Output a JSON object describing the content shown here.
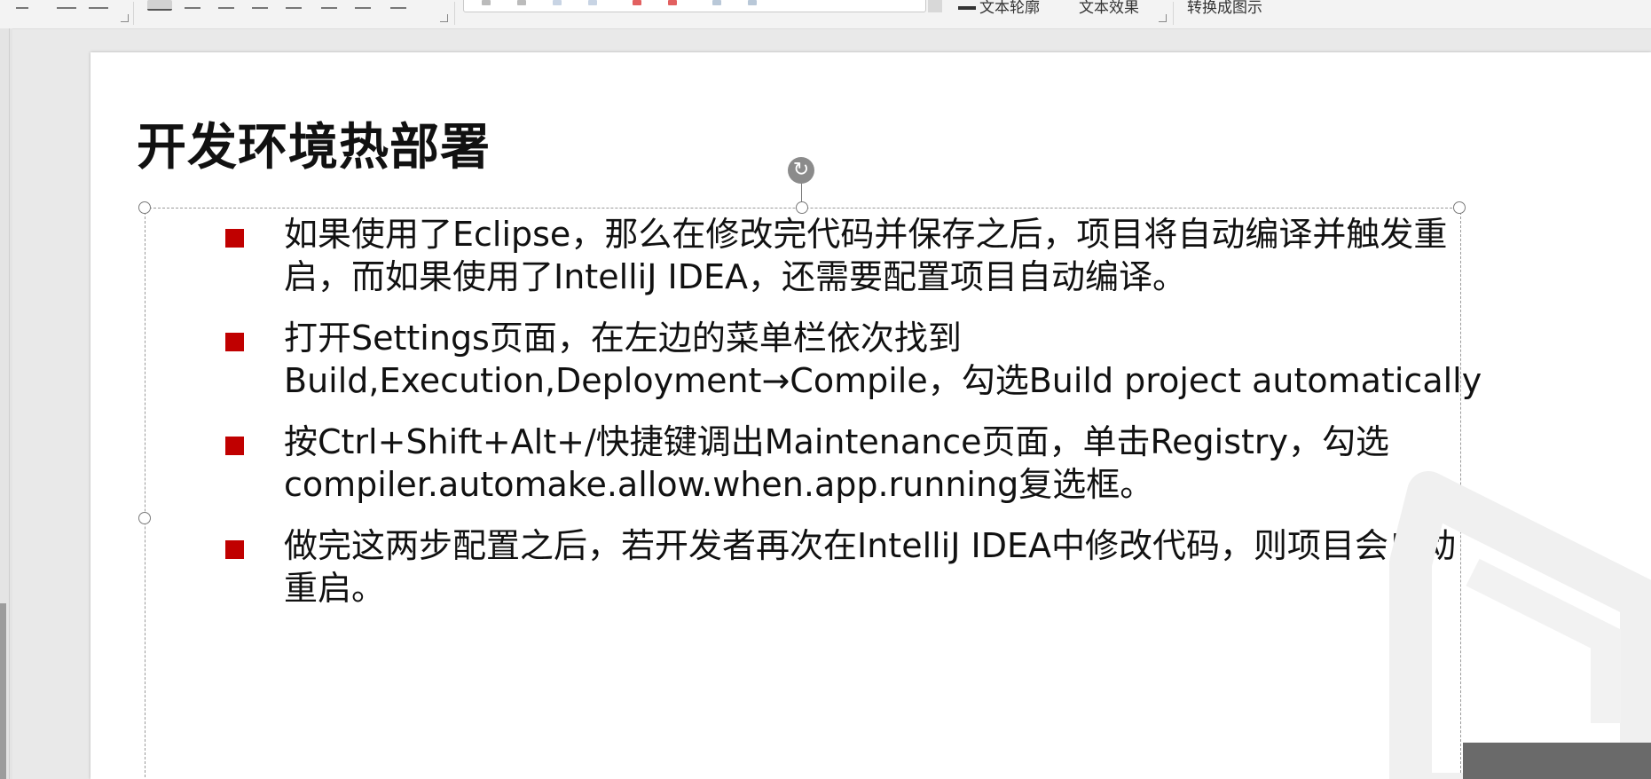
{
  "ribbon": {
    "text_outline_label": "文本轮廓",
    "text_effect_label": "文本效果",
    "convert_label": "转换成图示"
  },
  "slide": {
    "title": "开发环境热部署",
    "items": [
      {
        "text": "如果使用了Eclipse，那么在修改完代码并保存之后，项目将自动编译并触发重\n启，而如果使用了IntelliJ IDEA，还需要配置项目自动编译。"
      },
      {
        "text": "打开Settings页面，在左边的菜单栏依次找到\nBuild,Execution,Deployment→Compile，勾选Build project automatically"
      },
      {
        "text": "按Ctrl+Shift+Alt+/快捷键调出Maintenance页面，单击Registry，勾选\ncompiler.automake.allow.when.app.running复选框。"
      },
      {
        "text": "做完这两步配置之后，若开发者再次在IntelliJ IDEA中修改代码，则项目会自动\n重启。"
      }
    ]
  },
  "icons": {
    "rotate": "rotate-handle-icon",
    "bullet": "square-bullet-icon",
    "watermark": "watermark-logo-icon"
  },
  "colors": {
    "bullet": "#c00000",
    "slide_bg": "#ffffff",
    "workspace_bg": "#e9e9e9"
  }
}
